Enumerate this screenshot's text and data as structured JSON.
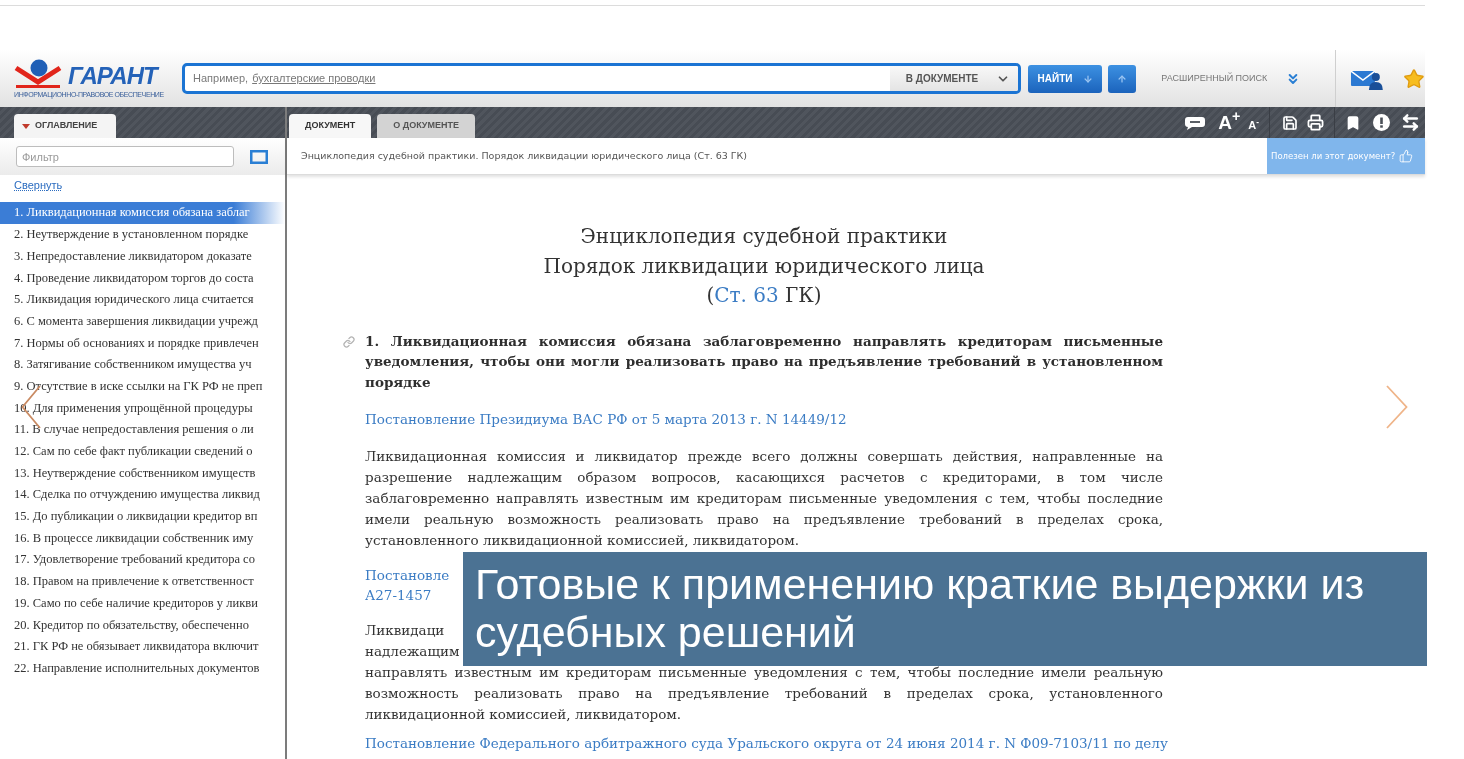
{
  "app": {
    "logo": {
      "name": "ГАРАНТ",
      "tagline": "ИНФОРМАЦИОННО-ПРАВОВОЕ ОБЕСПЕЧЕНИЕ"
    },
    "search": {
      "hint": "Например,",
      "example": "бухгалтерские проводки",
      "scope": "В ДОКУМЕНТЕ",
      "find_button": "НАЙТИ",
      "advanced": "РАСШИРЕННЫЙ ПОИСК"
    },
    "sidebar": {
      "tab": "ОГЛАВЛЕНИЕ",
      "filter": {
        "placeholder": "Фильтр"
      },
      "collapse_link": "Свернуть",
      "items": [
        {
          "label": "1. Ликвидационная комиссия обязана заблаг",
          "selected": true
        },
        {
          "label": "2. Неутверждение в установленном порядке",
          "selected": false
        },
        {
          "label": "3. Непредоставление ликвидатором доказате",
          "selected": false
        },
        {
          "label": "4. Проведение ликвидатором торгов до соста",
          "selected": false
        },
        {
          "label": "5. Ликвидация юридического лица считается",
          "selected": false
        },
        {
          "label": "6. С момента завершения ликвидации учрежд",
          "selected": false
        },
        {
          "label": "7. Нормы об основаниях и порядке привлечен",
          "selected": false
        },
        {
          "label": "8. Затягивание собственником имущества уч",
          "selected": false
        },
        {
          "label": "9. Отсутствие в иске ссылки на ГК РФ не преп",
          "selected": false
        },
        {
          "label": "10. Для применения упрощённой процедуры",
          "selected": false
        },
        {
          "label": "11. В случае непредоставления решения о ли",
          "selected": false
        },
        {
          "label": "12. Сам по себе факт публикации сведений о",
          "selected": false
        },
        {
          "label": "13. Неутверждение собственником имуществ",
          "selected": false
        },
        {
          "label": "14. Сделка по отчуждению имущества ликвид",
          "selected": false
        },
        {
          "label": "15. До публикации о ликвидации кредитор вп",
          "selected": false
        },
        {
          "label": "16. В процессе ликвидации собственник иму",
          "selected": false
        },
        {
          "label": "17. Удовлетворение требований кредитора со",
          "selected": false
        },
        {
          "label": "18. Правом на привлечение к ответственност",
          "selected": false
        },
        {
          "label": "19. Само по себе наличие кредиторов у ликви",
          "selected": false
        },
        {
          "label": "20. Кредитор по обязательству, обеспеченно",
          "selected": false
        },
        {
          "label": "21. ГК РФ не обязывает ликвидатора включит",
          "selected": false
        },
        {
          "label": "22. Направление исполнительных документов",
          "selected": false
        }
      ]
    },
    "document": {
      "tabs": [
        {
          "label": "ДОКУМЕНТ",
          "selected": true
        },
        {
          "label": "О ДОКУМЕНТЕ",
          "selected": false
        }
      ],
      "toolbar": {
        "font_larger": "A$^{+}$",
        "font_smaller": "A$^{-}$"
      },
      "breadcrumb": "Энциклопедия судебной практики. Порядок ликвидации юридического лица (Ст. 63 ГК)",
      "feedback": "Полезен ли этот документ?",
      "title_lines": [
        "Энциклопедия судебной практики",
        "Порядок ликвидации юридического лица"
      ],
      "article_ref": {
        "before": "(",
        "link": "Ст. 63",
        "after": " ГК)"
      },
      "blocks": [
        {
          "kind": "heading",
          "text": "1. Ликвидационная комиссия обязана заблаговременно направлять кредиторам письменные уведомления, чтобы они могли реализовать право на предъявление требований в установленном порядке"
        },
        {
          "kind": "link",
          "text": "Постановление Президиума ВАС РФ от 5 марта 2013 г. N 14449/12"
        },
        {
          "kind": "paragraph",
          "text": "Ликвидационная комиссия и ликвидатор прежде всего должны совершать действия, направленные на разрешение надлежащим образом вопросов, касающихся расчетов с кредиторами, в том числе заблаговременно направлять известным им кредиторам письменные уведомления с тем, чтобы последние имели реальную возможность реализовать право на предъявление требований в пределах срока, установленного ликвидационной комиссией, ликвидатором."
        },
        {
          "kind": "covered_link",
          "lines": [
            "Постановле",
            "А27-1457"
          ]
        },
        {
          "kind": "covered_paragraph",
          "lines": [
            "Ликвидаци",
            "надлежащим"
          ],
          "rest": "направлять известным им кредиторам письменные уведомления с тем, чтобы последние имели реальную возможность реализовать право на предъявление требований в пределах срока, установленного ликвидационной комиссией, ликвидатором."
        },
        {
          "kind": "link",
          "text": "Постановление Федерального арбитражного суда Уральского округа от 24 июня 2014 г. N Ф09-7103/11 по делу"
        }
      ]
    }
  },
  "caption": "Готовые к применению краткие выдержки из судебных решений"
}
